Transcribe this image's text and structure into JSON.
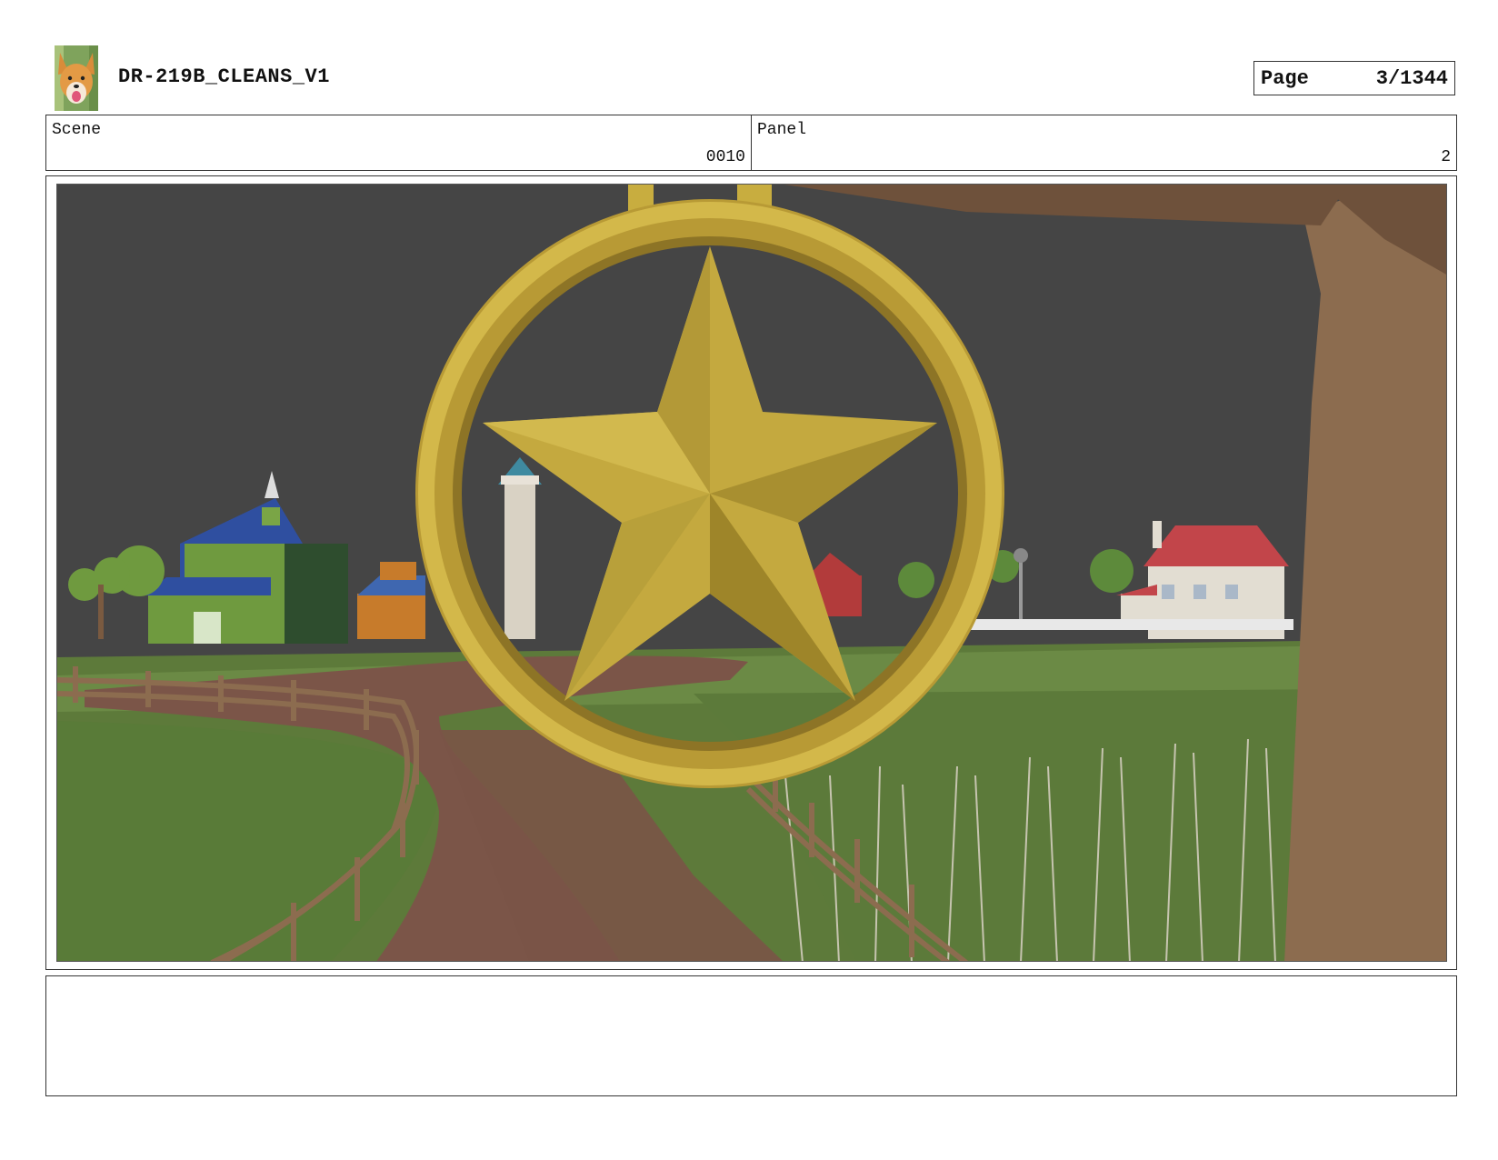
{
  "header": {
    "title": "DR-219B_CLEANS_V1",
    "logo_icon": "corgi-dog-logo",
    "page_label": "Page",
    "page_value": "3/1344"
  },
  "info": {
    "scene_label": "Scene",
    "scene_value": "0010",
    "panel_label": "Panel",
    "panel_value": "2"
  },
  "panel": {
    "image_icon": "farm-scene-star-sign-image"
  },
  "notes": {
    "text": ""
  },
  "colors": {
    "sky": "#454545",
    "grass": "#5d7a3a",
    "path": "#7b5548",
    "gold": "#c8ad3f",
    "wood": "#8c6c4f"
  }
}
